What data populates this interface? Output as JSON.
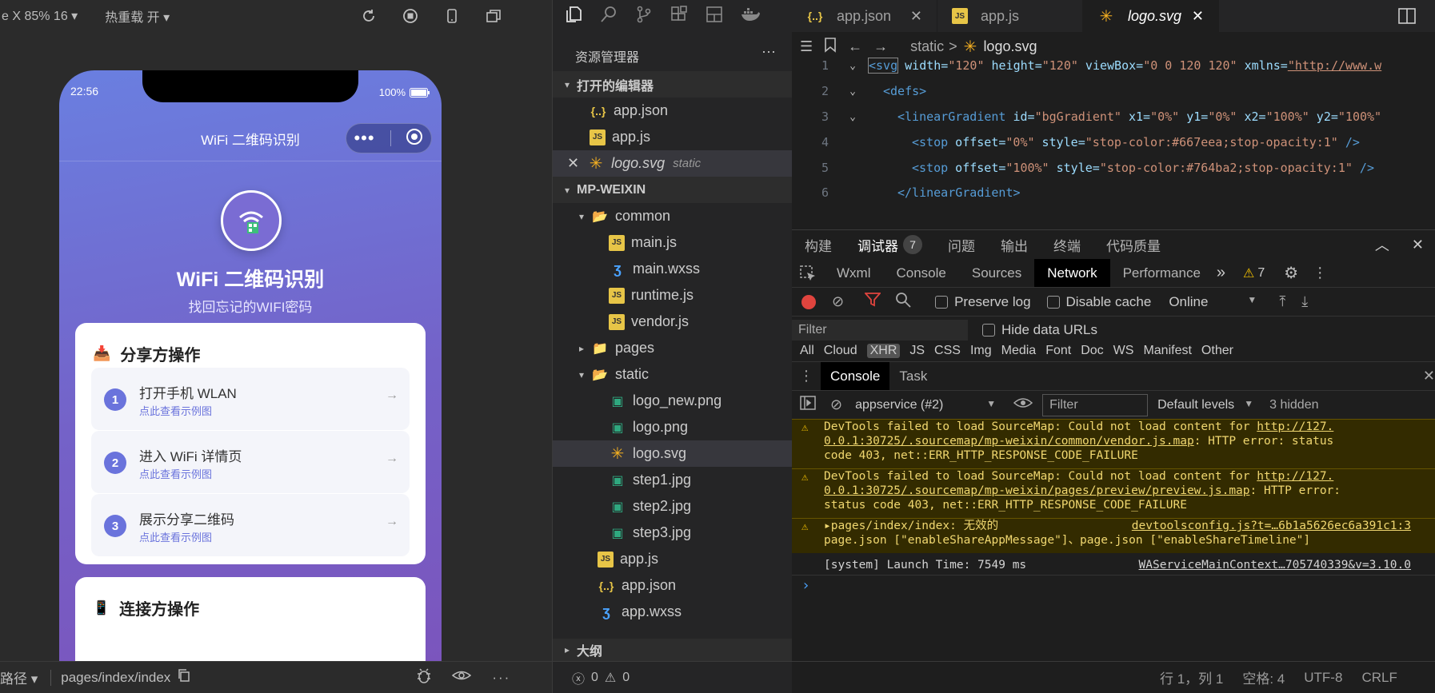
{
  "simulator": {
    "device_label": "e X 85% 16 ▾",
    "hotreload_label": "热重载 开 ▾",
    "phone": {
      "time": "22:56",
      "battery": "100%",
      "nav_title": "WiFi 二维码识别",
      "app_title": "WiFi 二维码识别",
      "app_subtitle": "找回忘记的WIFI密码",
      "share_card": {
        "title": "分享方操作",
        "steps": [
          {
            "num": "1",
            "title": "打开手机 WLAN",
            "sub": "点此查看示例图",
            "arrow": "→"
          },
          {
            "num": "2",
            "title": "进入 WiFi 详情页",
            "sub": "点此查看示例图",
            "arrow": "→"
          },
          {
            "num": "3",
            "title": "展示分享二维码",
            "sub": "点此查看示例图",
            "arrow": "→"
          }
        ]
      },
      "connect_card": {
        "title": "连接方操作"
      }
    },
    "bottom": {
      "path_label": "路径 ▾",
      "page_path": "pages/index/index"
    }
  },
  "explorer": {
    "title": "资源管理器",
    "more": "···",
    "open_editors_label": "打开的编辑器",
    "open_editors": [
      {
        "name": "app.json",
        "icon": "json"
      },
      {
        "name": "app.js",
        "icon": "js"
      },
      {
        "name": "logo.svg",
        "icon": "svg",
        "hint": "static"
      }
    ],
    "project_label": "MP-WEIXIN",
    "tree": [
      {
        "name": "common",
        "icon": "folder",
        "depth": 1,
        "expanded": "▾"
      },
      {
        "name": "main.js",
        "icon": "js",
        "depth": 2
      },
      {
        "name": "main.wxss",
        "icon": "css",
        "depth": 2
      },
      {
        "name": "runtime.js",
        "icon": "js",
        "depth": 2
      },
      {
        "name": "vendor.js",
        "icon": "js",
        "depth": 2
      },
      {
        "name": "pages",
        "icon": "folder-pages",
        "depth": 1,
        "expanded": "▸"
      },
      {
        "name": "static",
        "icon": "folder",
        "depth": 1,
        "expanded": "▾"
      },
      {
        "name": "logo_new.png",
        "icon": "img",
        "depth": 2
      },
      {
        "name": "logo.png",
        "icon": "img",
        "depth": 2
      },
      {
        "name": "logo.svg",
        "icon": "svg",
        "depth": 2,
        "selected": true
      },
      {
        "name": "step1.jpg",
        "icon": "img",
        "depth": 2
      },
      {
        "name": "step2.jpg",
        "icon": "img",
        "depth": 2
      },
      {
        "name": "step3.jpg",
        "icon": "img",
        "depth": 2
      },
      {
        "name": "app.js",
        "icon": "js",
        "depth": 1
      },
      {
        "name": "app.json",
        "icon": "json",
        "depth": 1
      },
      {
        "name": "app.wxss",
        "icon": "css",
        "depth": 1
      }
    ],
    "outline_label": "大纲",
    "status": {
      "errors": "0",
      "warnings": "0"
    }
  },
  "editor": {
    "tabs": [
      {
        "name": "app.json",
        "icon": "json"
      },
      {
        "name": "app.js",
        "icon": "js"
      },
      {
        "name": "logo.svg",
        "icon": "svg",
        "active": true,
        "close": "✕"
      }
    ],
    "breadcrumb": {
      "folder": "static",
      "sep": ">",
      "file": "logo.svg"
    },
    "lines": [
      {
        "n": "1",
        "fold": "⌄"
      },
      {
        "n": "2",
        "fold": "⌄"
      },
      {
        "n": "3",
        "fold": "⌄"
      },
      {
        "n": "4",
        "fold": ""
      },
      {
        "n": "5",
        "fold": ""
      },
      {
        "n": "6",
        "fold": ""
      }
    ],
    "code": {
      "l1_tag": "<svg",
      "l1_a1": " width=",
      "l1_v1": "\"120\"",
      "l1_a2": " height=",
      "l1_v2": "\"120\"",
      "l1_a3": " viewBox=",
      "l1_v3": "\"0 0 120 120\"",
      "l1_a4": " xmlns=",
      "l1_v4": "\"http://www.w",
      "l2_tag": "<defs>",
      "l3_tag": "<linearGradient",
      "l3_a1": " id=",
      "l3_v1": "\"bgGradient\"",
      "l3_a2": " x1=",
      "l3_v2": "\"0%\"",
      "l3_a3": " y1=",
      "l3_v3": "\"0%\"",
      "l3_a4": " x2=",
      "l3_v4": "\"100%\"",
      "l3_a5": " y2=",
      "l3_v5": "\"100%\"",
      "l4_tag": "<stop",
      "l4_a1": " offset=",
      "l4_v1": "\"0%\"",
      "l4_a2": " style=",
      "l4_v2": "\"stop-color:#667eea;stop-opacity:1\"",
      "l4_end": " />",
      "l5_tag": "<stop",
      "l5_a1": " offset=",
      "l5_v1": "\"100%\"",
      "l5_a2": " style=",
      "l5_v2": "\"stop-color:#764ba2;stop-opacity:1\"",
      "l5_end": " />",
      "l6_tag": "</linearGradient>"
    }
  },
  "devtools": {
    "panel_tabs": [
      "构建",
      "调试器",
      "问题",
      "输出",
      "终端",
      "代码质量"
    ],
    "debugger_badge": "7",
    "tool_tabs": [
      "Wxml",
      "Console",
      "Sources",
      "Network",
      "Performance"
    ],
    "more_tabs": "»",
    "warn_count": "7",
    "network_bar": {
      "preserve_log": "Preserve log",
      "disable_cache": "Disable cache",
      "throttle": "Online"
    },
    "filter_placeholder": "Filter",
    "hide_data_urls": "Hide data URLs",
    "type_filters": [
      "All",
      "Cloud",
      "XHR",
      "JS",
      "CSS",
      "Img",
      "Media",
      "Font",
      "Doc",
      "WS",
      "Manifest",
      "Other"
    ],
    "drawer_tabs": [
      "Console",
      "Task"
    ],
    "context": "appservice (#2)",
    "console_filter": "Filter",
    "levels": "Default levels",
    "hidden": "3 hidden",
    "messages": [
      {
        "l1": "DevTools failed to load SourceMap: Could not load content for ",
        "l1_link": "http://127.",
        "l2_link": "0.0.1:30725/.sourcemap/mp-weixin/common/vendor.js.map",
        "l2": ": HTTP error: status",
        "l3": "code 403, net::ERR_HTTP_RESPONSE_CODE_FAILURE"
      },
      {
        "l1": "DevTools failed to load SourceMap: Could not load content for ",
        "l1_link": "http://127.",
        "l2_link": "0.0.1:30725/.sourcemap/mp-weixin/pages/preview/preview.js.map",
        "l2": ": HTTP error:",
        "l3": "status code 403, net::ERR_HTTP_RESPONSE_CODE_FAILURE"
      },
      {
        "l1": "▸pages/index/index: 无效的",
        "l1_link": "devtoolsconfig.js?t=…6b1a5626ec6a391c1:3",
        "l2": "page.json [\"enableShareAppMessage\"]、page.json [\"enableShareTimeline\"]"
      }
    ],
    "system_msg": "[system] Launch Time: 7549 ms",
    "system_link": "WAServiceMainContext…705740339&v=3.10.0",
    "prompt": "›"
  },
  "statusbar": {
    "position": "行 1，列 1",
    "spaces": "空格: 4",
    "encoding": "UTF-8",
    "eol": "CRLF"
  }
}
